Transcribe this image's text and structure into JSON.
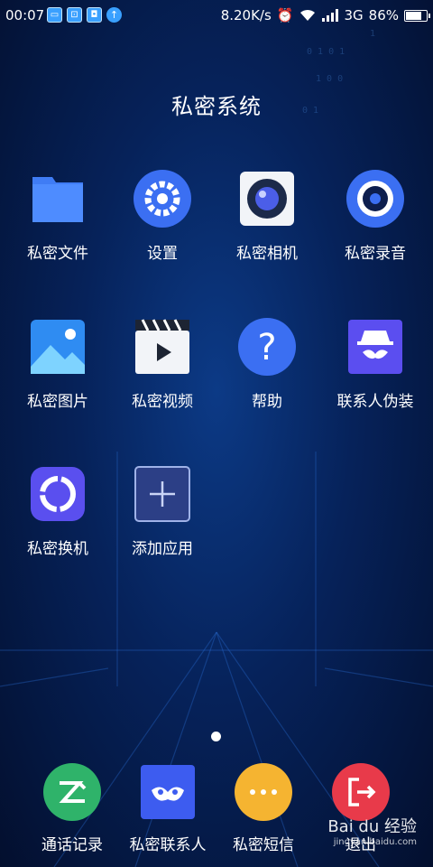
{
  "status_bar": {
    "time": "00:07",
    "speed": "8.20K/s",
    "network": "3G",
    "battery": "86%",
    "battery_level": 0.86,
    "notification_icons": [
      "message-icon",
      "scan-icon",
      "shield-icon",
      "upload-icon"
    ]
  },
  "title": "私密系统",
  "apps": [
    {
      "label": "私密文件",
      "icon": "folder-icon"
    },
    {
      "label": "设置",
      "icon": "gear-icon"
    },
    {
      "label": "私密相机",
      "icon": "camera-icon"
    },
    {
      "label": "私密录音",
      "icon": "recorder-icon"
    },
    {
      "label": "私密图片",
      "icon": "picture-icon"
    },
    {
      "label": "私密视频",
      "icon": "clapperboard-icon"
    },
    {
      "label": "帮助",
      "icon": "question-icon"
    },
    {
      "label": "联系人伪装",
      "icon": "spy-icon"
    },
    {
      "label": "私密换机",
      "icon": "swap-ring-icon"
    },
    {
      "label": "添加应用",
      "icon": "plus-icon"
    }
  ],
  "dock": [
    {
      "label": "通话记录",
      "icon": "call-log-icon"
    },
    {
      "label": "私密联系人",
      "icon": "mask-contact-icon"
    },
    {
      "label": "私密短信",
      "icon": "sms-bubble-icon"
    },
    {
      "label": "退出",
      "icon": "exit-icon"
    }
  ],
  "watermark": {
    "brand": "Bai du 经验",
    "url": "jingyan.baidu.com"
  }
}
